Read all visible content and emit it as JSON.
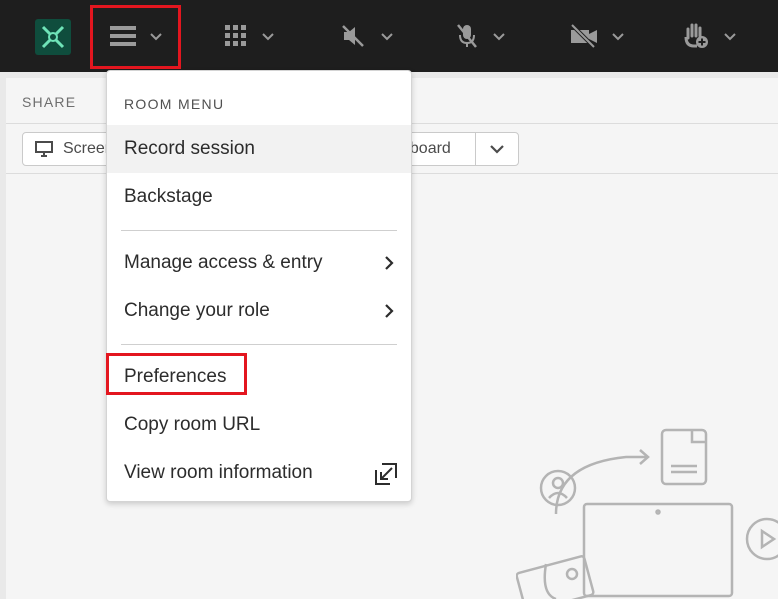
{
  "share": {
    "label": "SHARE"
  },
  "share_tools": {
    "screen_label": "Screen",
    "whiteboard_label": "eboard"
  },
  "room_menu": {
    "heading": "ROOM MENU",
    "items": [
      {
        "label": "Record session"
      },
      {
        "label": "Backstage"
      },
      {
        "label": "Manage access & entry"
      },
      {
        "label": "Change your role"
      },
      {
        "label": "Preferences"
      },
      {
        "label": "Copy room URL"
      },
      {
        "label": "View room information"
      }
    ]
  },
  "colors": {
    "topbar": "#1e1e1e",
    "highlight": "#e3161f",
    "logo": "#0f4d3d",
    "menu_hover": "#f2f2f2"
  },
  "icons": [
    "app-logo-icon",
    "hamburger-menu-icon",
    "grid-icon",
    "speaker-muted-icon",
    "mic-muted-icon",
    "camera-off-icon",
    "raise-hand-icon",
    "chevron-down-icon",
    "chevron-right-icon",
    "open-external-icon",
    "monitor-icon"
  ]
}
